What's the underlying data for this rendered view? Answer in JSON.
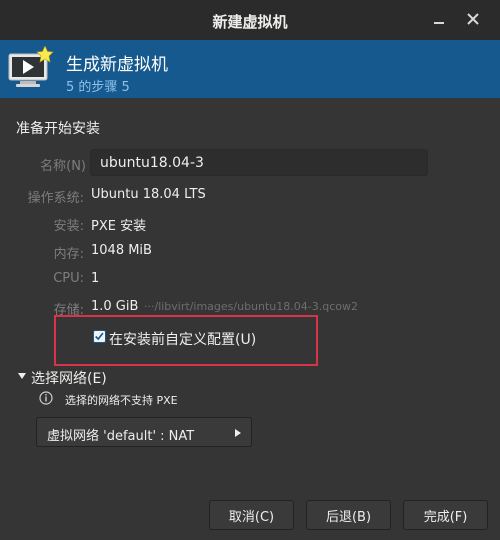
{
  "window": {
    "title": "新建虚拟机"
  },
  "header": {
    "title": "生成新虚拟机",
    "step": "5 的步骤 5"
  },
  "section": {
    "title": "准备开始安装"
  },
  "form": {
    "name": {
      "label": "名称(N)",
      "value": "ubuntu18.04-3"
    },
    "os": {
      "label": "操作系统:",
      "value": "Ubuntu 18.04 LTS"
    },
    "install": {
      "label": "安装:",
      "value": "PXE 安装"
    },
    "memory": {
      "label": "内存:",
      "value": "1048 MiB"
    },
    "cpu": {
      "label": "CPU:",
      "value": "1"
    },
    "storage": {
      "label": "存储:",
      "value": "1.0 GiB",
      "path": "···/libvirt/images/ubuntu18.04-3.qcow2"
    }
  },
  "customize": {
    "label": "在安装前自定义配置(U)",
    "checked": true
  },
  "network": {
    "expander_label": "选择网络(E)",
    "info_text": "选择的网络不支持 PXE",
    "selected": "虚拟网络 'default' : NAT"
  },
  "buttons": {
    "cancel": "取消(C)",
    "back": "后退(B)",
    "finish": "完成(F)"
  },
  "colors": {
    "header_bg": "#16598f",
    "highlight": "#d9334a",
    "window_bg": "#353535"
  },
  "icons": {
    "minimize": "minimize-icon",
    "close": "close-icon",
    "wizard": "vm-monitor-icon",
    "info": "info-icon"
  }
}
